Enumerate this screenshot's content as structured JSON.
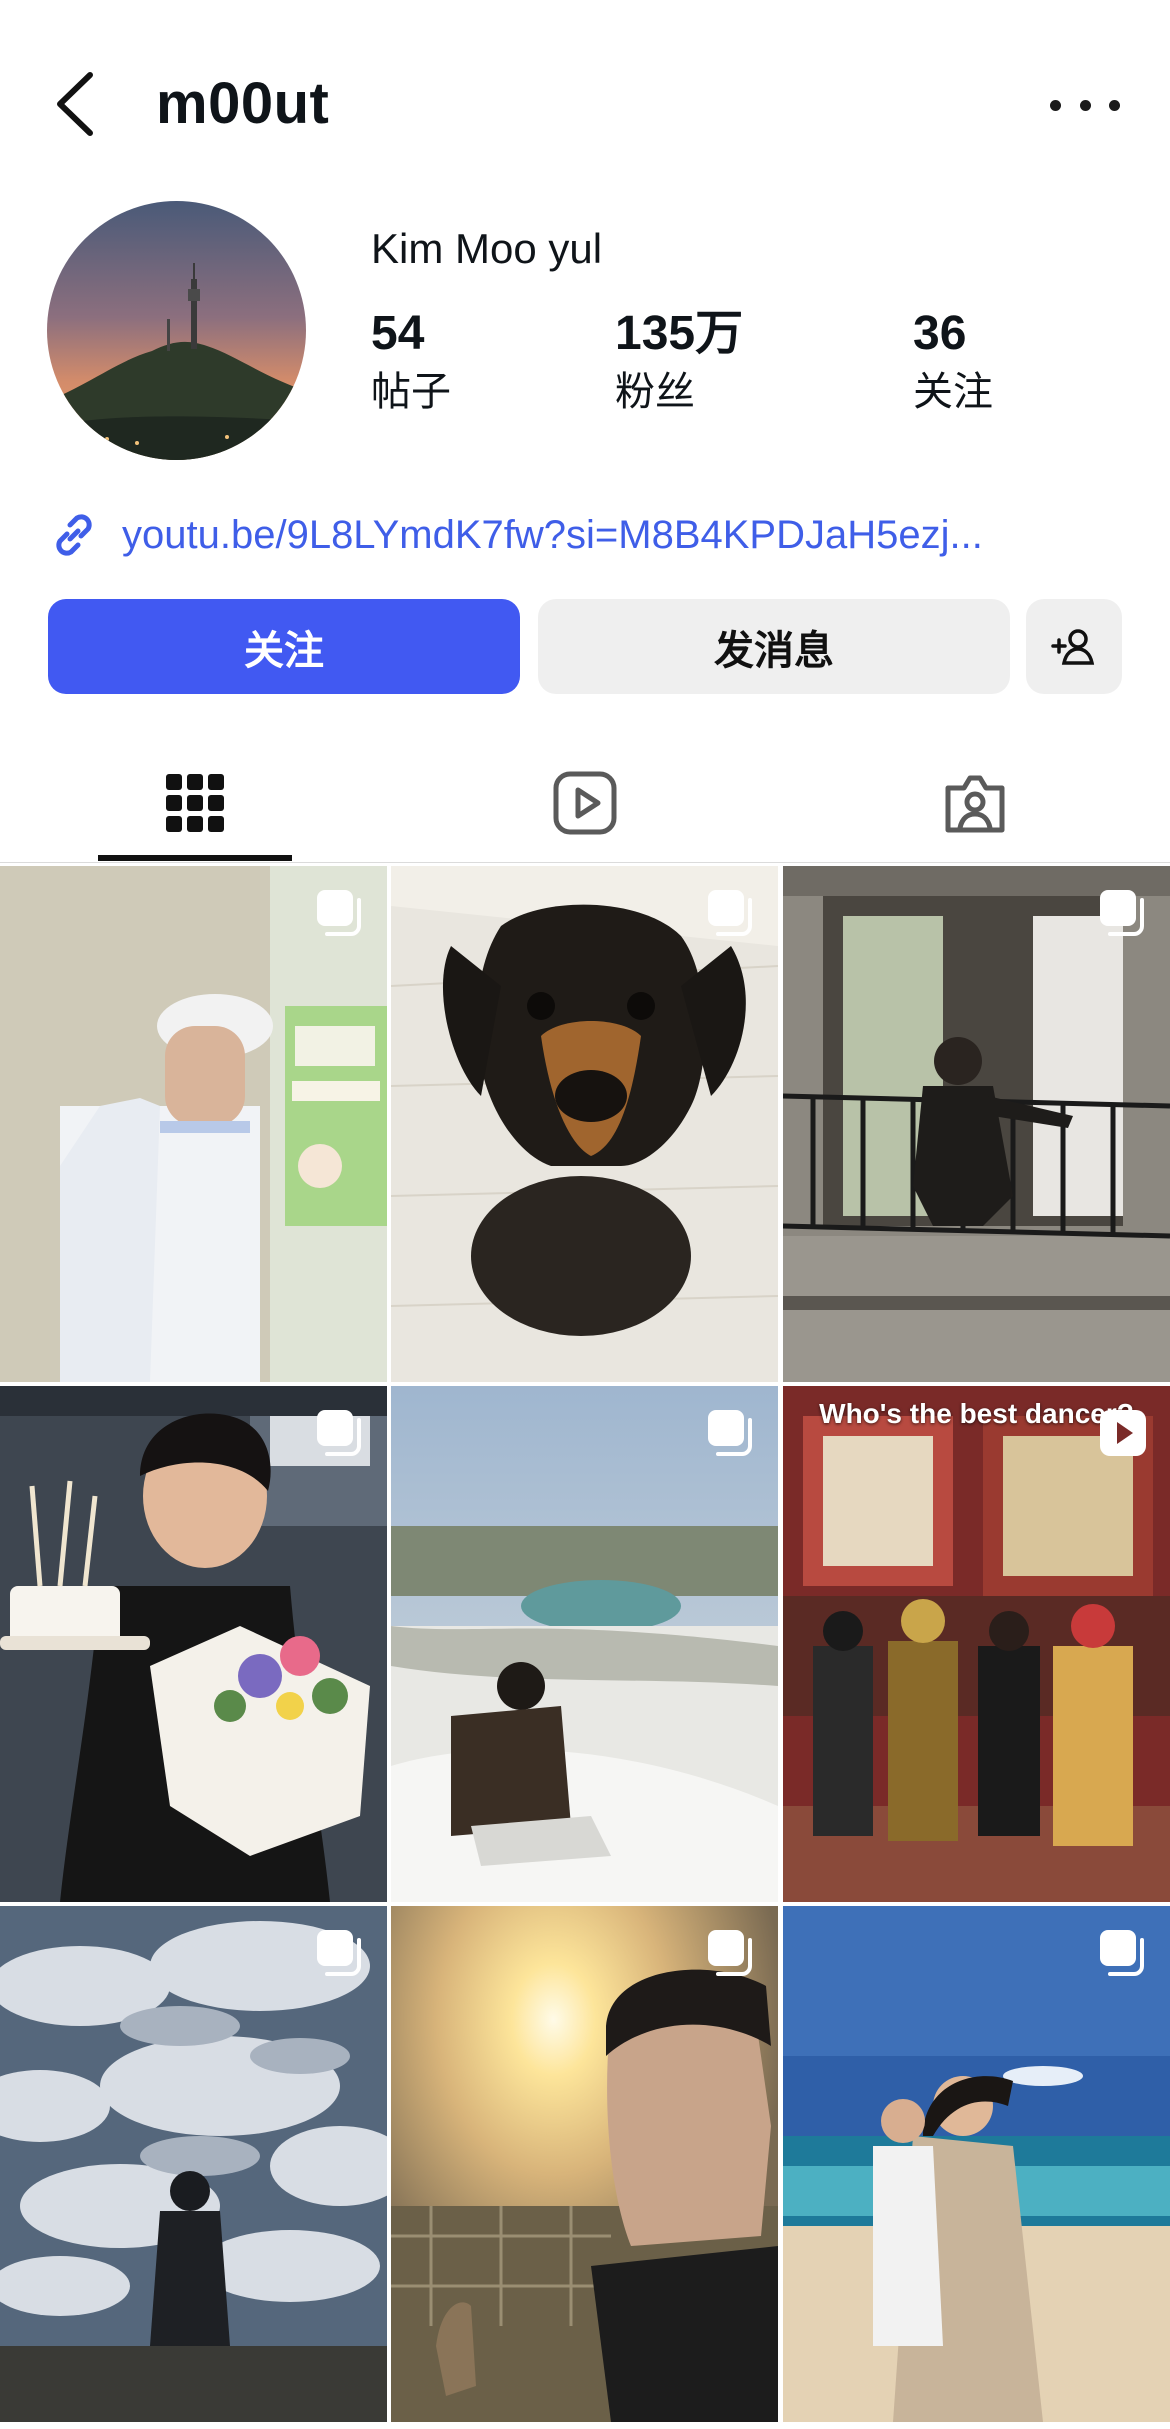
{
  "header": {
    "username": "m00ut"
  },
  "profile": {
    "display_name": "Kim Moo yul",
    "stats": [
      {
        "value": "54",
        "label": "帖子"
      },
      {
        "value": "135万",
        "label": "粉丝"
      },
      {
        "value": "36",
        "label": "关注"
      }
    ],
    "link": "youtu.be/9L8LYmdK7fw?si=M8B4KPDJaH5ezj..."
  },
  "actions": {
    "follow_label": "关注",
    "message_label": "发消息"
  },
  "colors": {
    "accent": "#4159f2",
    "link": "#3f5ee8",
    "button_secondary": "#efefef"
  },
  "tabs": [
    {
      "icon": "grid-icon",
      "active": true
    },
    {
      "icon": "reels-icon",
      "active": false
    },
    {
      "icon": "tagged-icon",
      "active": false
    }
  ],
  "posts": [
    {
      "type": "carousel",
      "subject": "man in white chef uniform"
    },
    {
      "type": "carousel",
      "subject": "dachshund on quilt"
    },
    {
      "type": "carousel",
      "subject": "man on balcony"
    },
    {
      "type": "carousel",
      "subject": "man with cake and flowers"
    },
    {
      "type": "carousel",
      "subject": "man sitting above lake"
    },
    {
      "type": "reel",
      "subject": "group in costumes",
      "caption": "Who's the best dancer?"
    },
    {
      "type": "carousel",
      "subject": "silhouette under cloudy sky"
    },
    {
      "type": "carousel",
      "subject": "selfie at sunset with kangaroo"
    },
    {
      "type": "carousel",
      "subject": "two men at beach"
    }
  ]
}
